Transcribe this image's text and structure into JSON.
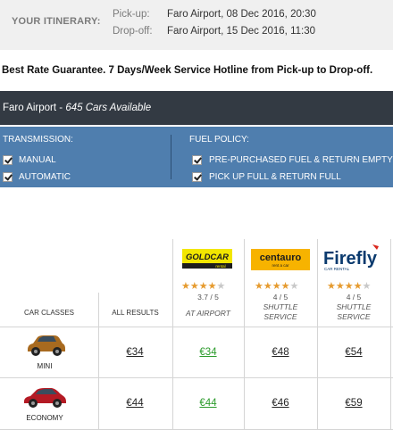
{
  "itinerary": {
    "title": "YOUR ITINERARY:",
    "pickup_label": "Pick-up:",
    "pickup_value": "Faro Airport, 08 Dec 2016, 20:30",
    "dropoff_label": "Drop-off:",
    "dropoff_value": "Faro Airport, 15 Dec 2016, 11:30"
  },
  "guarantee": "Best Rate Guarantee. 7 Days/Week Service Hotline from Pick-up to Drop-off.",
  "location": {
    "name": "Faro Airport",
    "separator": " - ",
    "count": "645 Cars Available"
  },
  "filters": {
    "transmission": {
      "title": "TRANSMISSION:",
      "options": [
        "MANUAL",
        "AUTOMATIC"
      ]
    },
    "fuel": {
      "title": "FUEL POLICY:",
      "options": [
        "PRE-PURCHASED FUEL & RETURN EMPTY",
        "PICK UP FULL & RETURN FULL"
      ]
    }
  },
  "table": {
    "headers": {
      "car_classes": "CAR CLASSES",
      "all_results": "ALL RESULTS"
    },
    "suppliers": [
      {
        "logo_text": "GOLDCAR",
        "logo_sub": "rental",
        "rating_value": 3.7,
        "rating": "3.7 / 5",
        "subtitle": "AT AIRPORT",
        "brand_color": "#f2e600"
      },
      {
        "logo_text": "centauro",
        "logo_sub": "rent a car",
        "rating_value": 4,
        "rating": "4 / 5",
        "subtitle": "SHUTTLE SERVICE",
        "brand_color": "#f7b300"
      },
      {
        "logo_text": "Firefly",
        "logo_sub": "CAR RENTAL",
        "rating_value": 4,
        "rating": "4 / 5",
        "subtitle": "SHUTTLE SERVICE",
        "brand_color": "#0a3a6e"
      }
    ],
    "rows": [
      {
        "car_class": "MINI",
        "car_color": "#a86a1f",
        "all": "€34",
        "prices": [
          "€34",
          "€48",
          "€54"
        ]
      },
      {
        "car_class": "ECONOMY",
        "car_color": "#b41a24",
        "all": "€44",
        "prices": [
          "€44",
          "€46",
          "€59"
        ]
      }
    ]
  }
}
